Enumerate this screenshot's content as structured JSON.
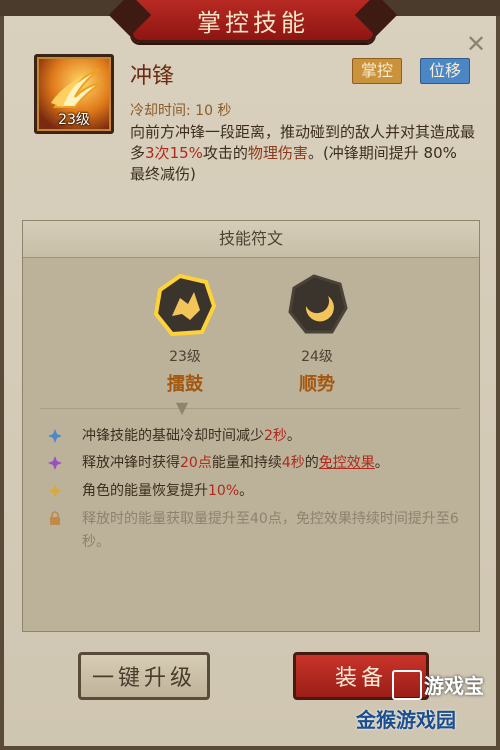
{
  "header": {
    "title": "掌控技能"
  },
  "skill": {
    "name": "冲锋",
    "level": "23级",
    "tags": [
      "掌控",
      "位移"
    ],
    "cooldown": "冷却时间: 10 秒",
    "description": {
      "p1": "向前方冲锋一段距离，推动碰到的敌人并对其造成最多",
      "hits": "3次",
      "pct": "15%",
      "p2": "攻击的",
      "dmg": "物理伤害",
      "p3": "。(冲锋期间提升 80% 最终减伤)"
    }
  },
  "runes": {
    "heading": "技能符文",
    "items": [
      {
        "name": "擂鼓",
        "level": "23级",
        "icon": "drum-rune-icon",
        "selected": true
      },
      {
        "name": "顺势",
        "level": "24级",
        "icon": "crescent-rune-icon",
        "selected": false
      }
    ]
  },
  "effects": [
    {
      "a": "冲锋技能的基础冷却时间减少",
      "b": "2秒",
      "c": "。",
      "icon": "blue-diamond-icon"
    },
    {
      "a": "释放冲锋时获得",
      "b": "20点",
      "c": "能量和持续",
      "d": "4秒",
      "e": "的",
      "f": "免控效果",
      "g": "。",
      "icon": "purple-diamond-icon"
    },
    {
      "a": "角色的能量恢复提升",
      "b": "10%",
      "c": "。",
      "icon": "yellow-diamond-icon"
    },
    {
      "a": "释放时的能量获取量提升至40点，免控效果持续时间提升至6秒。",
      "icon": "lock-icon"
    }
  ],
  "buttons": {
    "upgrade": "一键升级",
    "equip": "装备"
  },
  "watermark": {
    "line1": "游戏宝",
    "line2": "金猴游戏园"
  },
  "colors": {
    "highlight_red": "#b02a1c",
    "banner_red": "#a8211c",
    "tag_blue": "#4b86c5",
    "tag_gold": "#c9923b"
  }
}
